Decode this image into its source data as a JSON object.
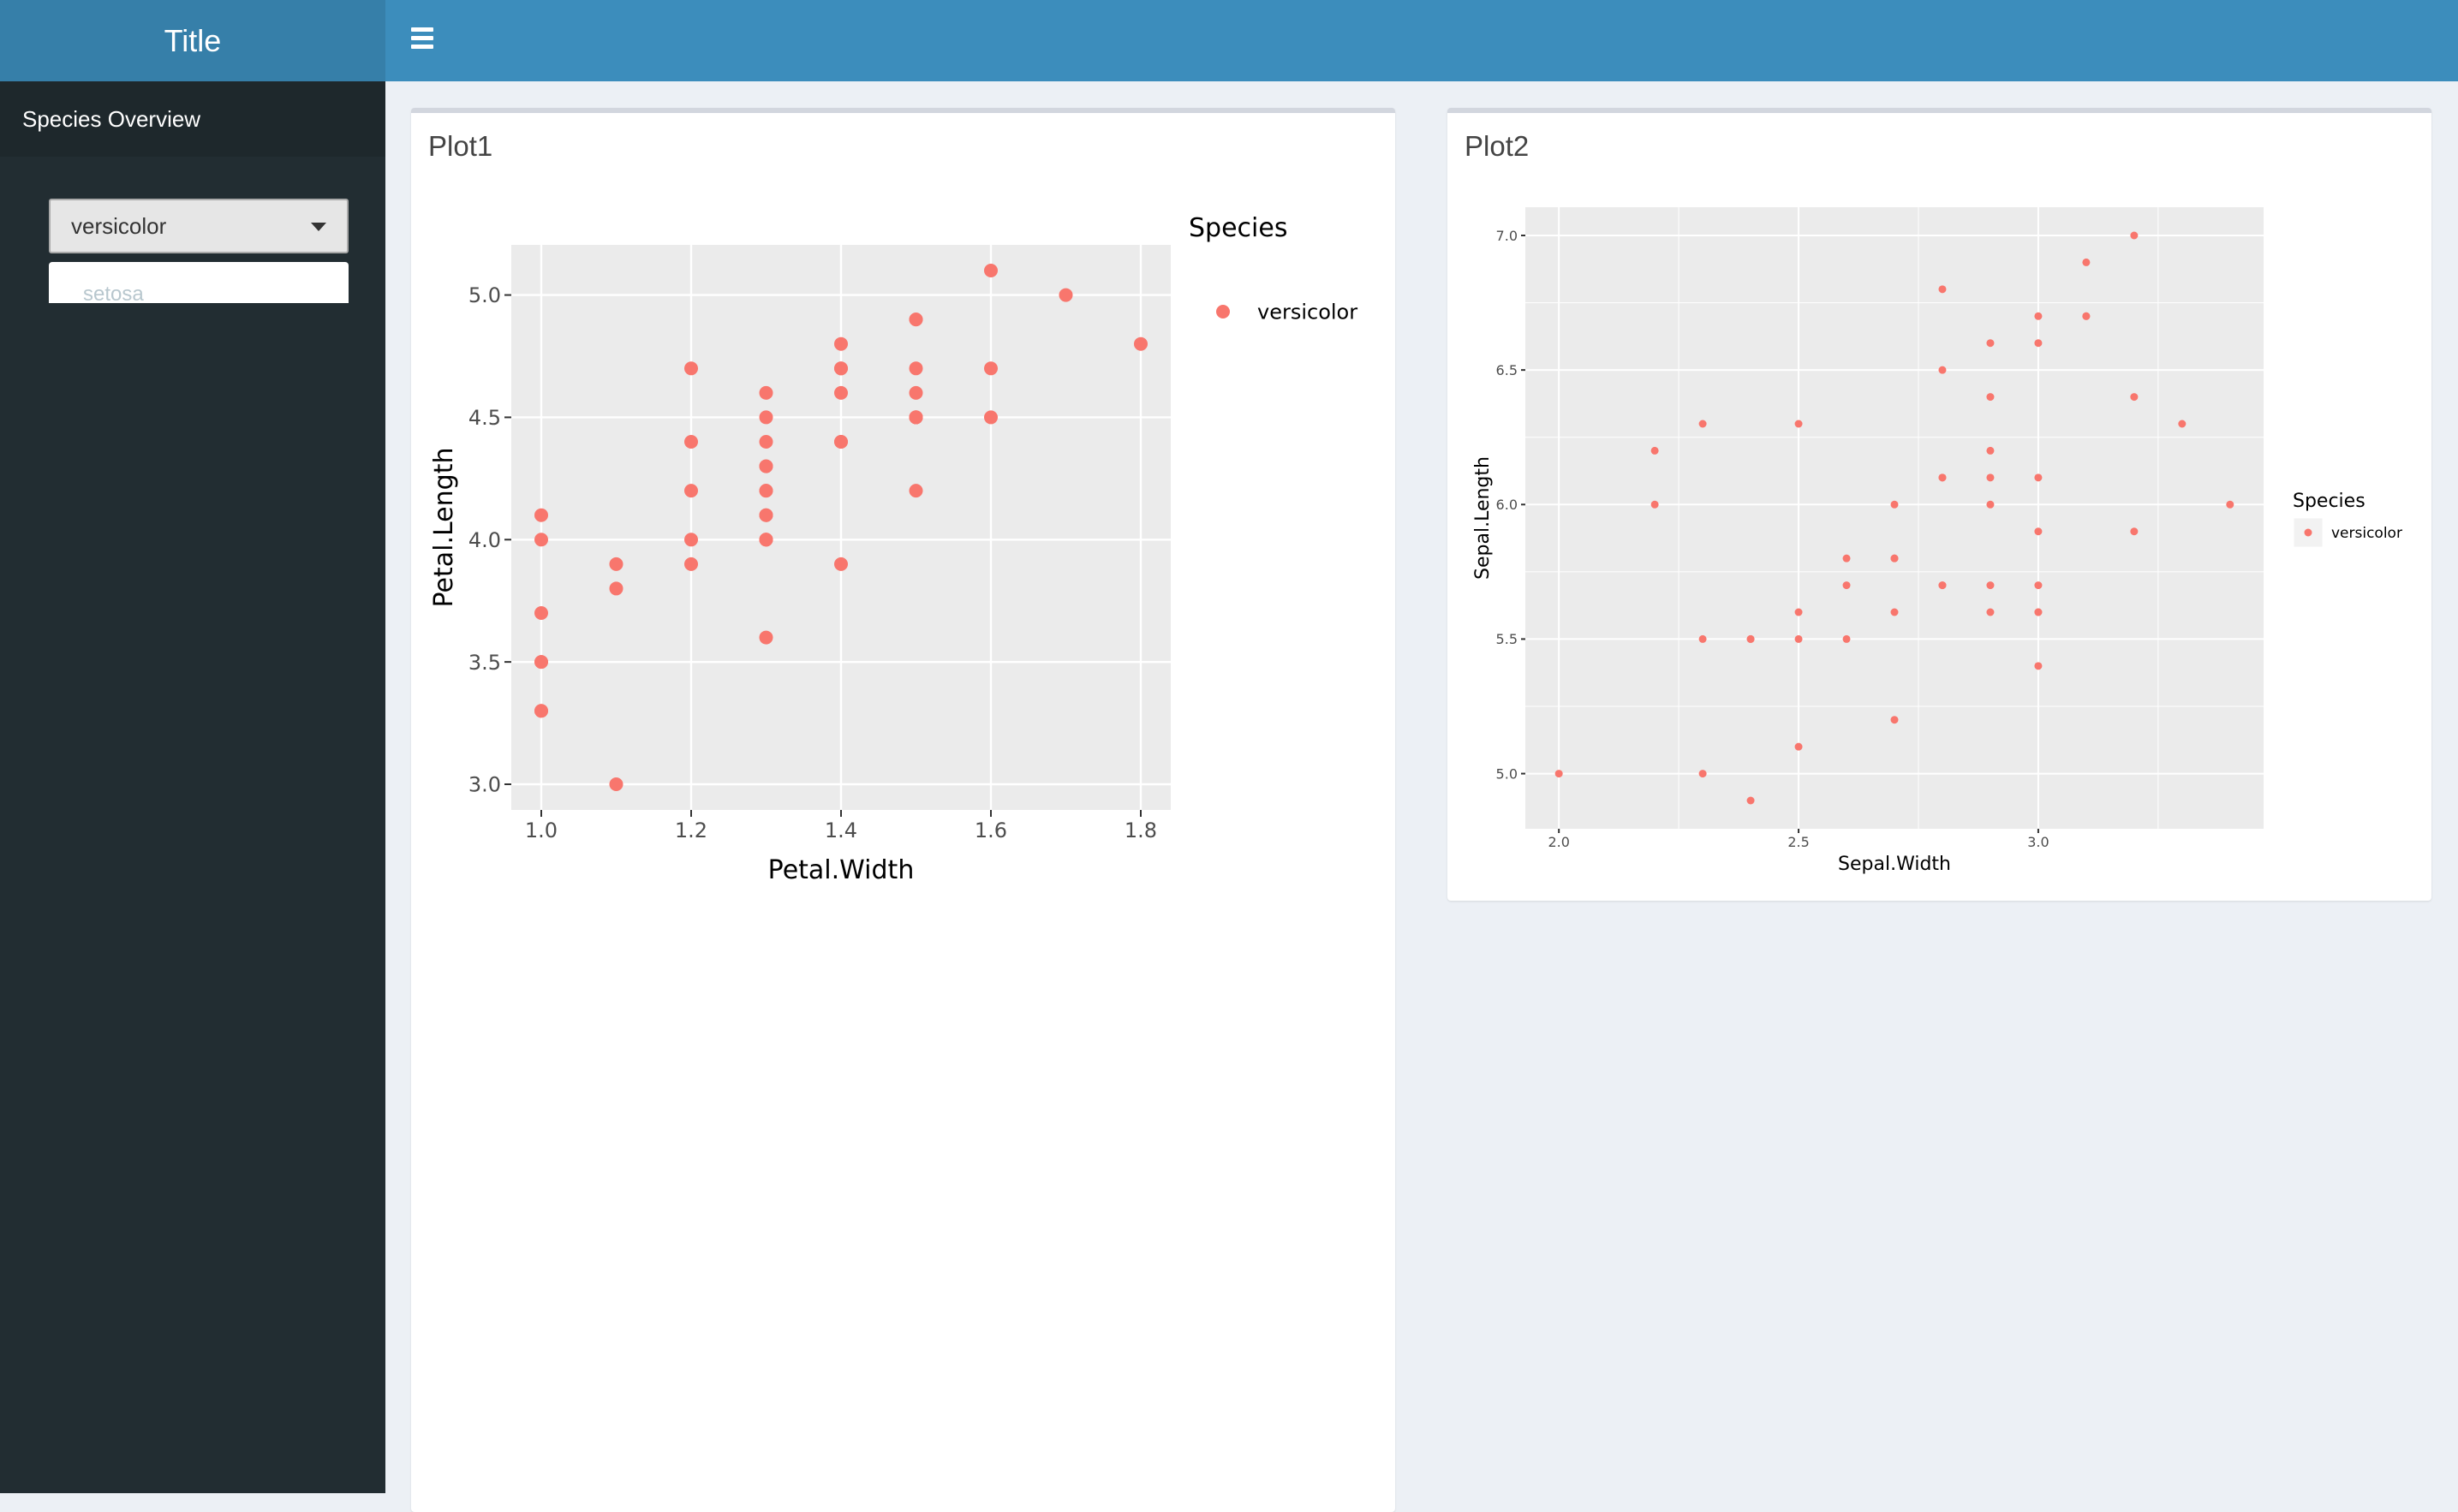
{
  "header": {
    "title": "Title",
    "menu_icon": "hamburger-icon"
  },
  "sidebar": {
    "menu_item": "Species Overview",
    "select": {
      "value": "versicolor",
      "options_visible": [
        "setosa"
      ]
    }
  },
  "boxes": [
    {
      "title": "Plot1"
    },
    {
      "title": "Plot2"
    }
  ],
  "colors": {
    "header": "#3c8dbc",
    "logo": "#367fa9",
    "sidebar": "#222d32",
    "point": "#f8766d",
    "panel": "#ebebeb"
  },
  "chart_data": [
    {
      "type": "scatter",
      "xlabel": "Petal.Width",
      "ylabel": "Petal.Length",
      "xlim": [
        0.96,
        1.84
      ],
      "ylim": [
        2.895,
        5.205
      ],
      "xticks": [
        "1.0",
        "1.2",
        "1.4",
        "1.6",
        "1.8"
      ],
      "yticks": [
        "3.0",
        "3.5",
        "4.0",
        "4.5",
        "5.0"
      ],
      "minor_grid": false,
      "legend": {
        "title": "Species",
        "entries": [
          "versicolor"
        ],
        "placement": "right"
      },
      "x": [
        1.4,
        1.5,
        1.5,
        1.3,
        1.5,
        1.3,
        1.6,
        1.0,
        1.3,
        1.4,
        1.0,
        1.5,
        1.0,
        1.4,
        1.3,
        1.4,
        1.5,
        1.0,
        1.5,
        1.1,
        1.8,
        1.3,
        1.5,
        1.2,
        1.3,
        1.4,
        1.4,
        1.7,
        1.5,
        1.0,
        1.1,
        1.0,
        1.2,
        1.6,
        1.5,
        1.6,
        1.5,
        1.3,
        1.3,
        1.3,
        1.2,
        1.4,
        1.2,
        1.0,
        1.3,
        1.2,
        1.3,
        1.3,
        1.1,
        1.3
      ],
      "y": [
        4.7,
        4.5,
        4.9,
        4.0,
        4.6,
        4.5,
        4.7,
        3.3,
        4.6,
        3.9,
        3.5,
        4.2,
        4.0,
        4.7,
        3.6,
        4.4,
        4.5,
        4.1,
        4.5,
        3.9,
        4.8,
        4.0,
        4.9,
        4.7,
        4.3,
        4.4,
        4.8,
        5.0,
        4.5,
        3.5,
        3.8,
        3.7,
        3.9,
        5.1,
        4.5,
        4.5,
        4.7,
        4.4,
        4.1,
        4.0,
        4.4,
        4.6,
        4.0,
        3.3,
        4.2,
        4.2,
        4.2,
        4.3,
        3.0,
        4.1
      ]
    },
    {
      "type": "scatter",
      "xlabel": "Sepal.Width",
      "ylabel": "Sepal.Length",
      "xlim": [
        1.93,
        3.47
      ],
      "ylim": [
        4.795,
        7.105
      ],
      "xticks": [
        "2.0",
        "2.5",
        "3.0"
      ],
      "yticks": [
        "5.0",
        "5.5",
        "6.0",
        "6.5",
        "7.0"
      ],
      "minor_grid": true,
      "legend": {
        "title": "Species",
        "entries": [
          "versicolor"
        ],
        "placement": "right"
      },
      "x": [
        3.2,
        3.2,
        3.1,
        2.3,
        2.8,
        2.8,
        3.3,
        2.4,
        2.9,
        2.7,
        2.0,
        3.0,
        2.2,
        2.9,
        2.9,
        3.1,
        3.0,
        2.7,
        2.2,
        2.5,
        3.2,
        2.8,
        2.5,
        2.8,
        2.9,
        3.0,
        2.8,
        3.0,
        2.9,
        2.6,
        2.4,
        2.4,
        2.7,
        2.7,
        3.0,
        3.4,
        3.1,
        2.3,
        3.0,
        2.5,
        2.6,
        3.0,
        2.6,
        2.3,
        2.7,
        3.0,
        2.9,
        2.9,
        2.5,
        2.8
      ],
      "y": [
        7.0,
        6.4,
        6.9,
        5.5,
        6.5,
        5.7,
        6.3,
        4.9,
        6.6,
        5.2,
        5.0,
        5.9,
        6.0,
        6.1,
        5.6,
        6.7,
        5.6,
        5.8,
        6.2,
        5.6,
        5.9,
        6.1,
        6.3,
        6.1,
        6.4,
        6.6,
        6.8,
        6.7,
        6.0,
        5.7,
        5.5,
        5.5,
        5.8,
        6.0,
        5.4,
        6.0,
        6.7,
        6.3,
        5.6,
        5.5,
        5.5,
        6.1,
        5.8,
        5.0,
        5.6,
        5.7,
        5.7,
        6.2,
        5.1,
        5.7
      ]
    }
  ]
}
